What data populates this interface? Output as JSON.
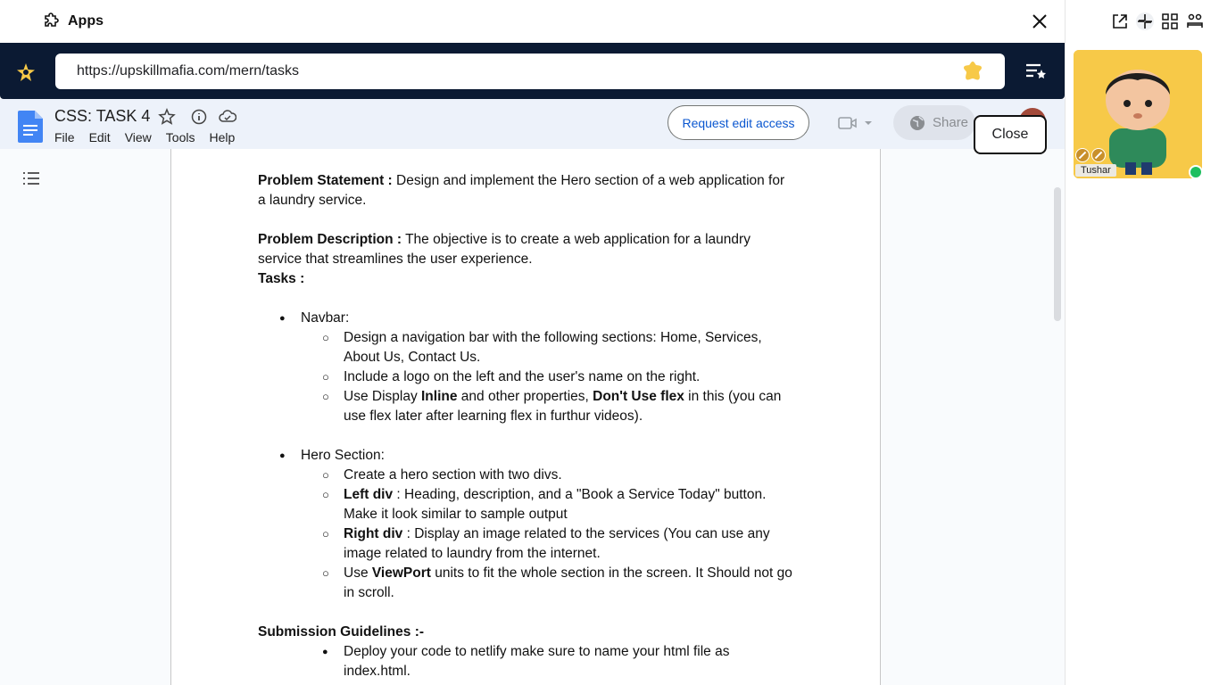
{
  "app": {
    "title": "Apps"
  },
  "browser": {
    "url": "https://upskillmafia.com/mern/tasks"
  },
  "doc": {
    "title": "CSS: TASK 4",
    "menu": [
      "File",
      "Edit",
      "View",
      "Tools",
      "Help"
    ],
    "request_edit": "Request edit access",
    "share": "Share",
    "close": "Close"
  },
  "participant": {
    "name": "Tushar",
    "status_color": "#1fbf5f"
  },
  "content": {
    "ps_label": "Problem Statement :",
    "ps_text": " Design and implement the Hero section of a web application for a laundry service.",
    "pd_label": "Problem Description :",
    "pd_text": " The objective is to create a web application for a laundry service that streamlines the user experience.",
    "tasks_label": "Tasks :",
    "navbar": {
      "title": "Navbar:",
      "i1": "Design a navigation bar with the following sections: Home, Services, About Us, Contact Us.",
      "i2": "Include a logo on the left and the user's name on the right.",
      "i3_a": "Use Display ",
      "i3_b": "Inline",
      "i3_c": " and other properties, ",
      "i3_d": "Don't Use flex",
      "i3_e": " in this (you can use flex later after learning flex in furthur videos)."
    },
    "hero": {
      "title": "Hero Section:",
      "i1": "Create a hero section with two divs.",
      "i2_label": "Left div",
      "i2_text": " : Heading, description, and a \"Book a Service Today\" button. Make it look similar to sample output",
      "i3_label": "Right div",
      "i3_text": " : Display an image related to the services (You can use any image related to laundry from the internet.",
      "i4_a": "Use ",
      "i4_b": "ViewPort",
      "i4_c": " units to fit the whole section in the screen. It Should not go in scroll."
    },
    "submission": {
      "title": "Submission Guidelines :-",
      "i1": "Deploy your code to netlify make sure to name your html file as index.html."
    }
  },
  "colors": {
    "navy": "#0b1a33",
    "docs_blue": "#4285f4",
    "accent_yellow": "#f7c948",
    "link_blue": "#0b57d0"
  }
}
